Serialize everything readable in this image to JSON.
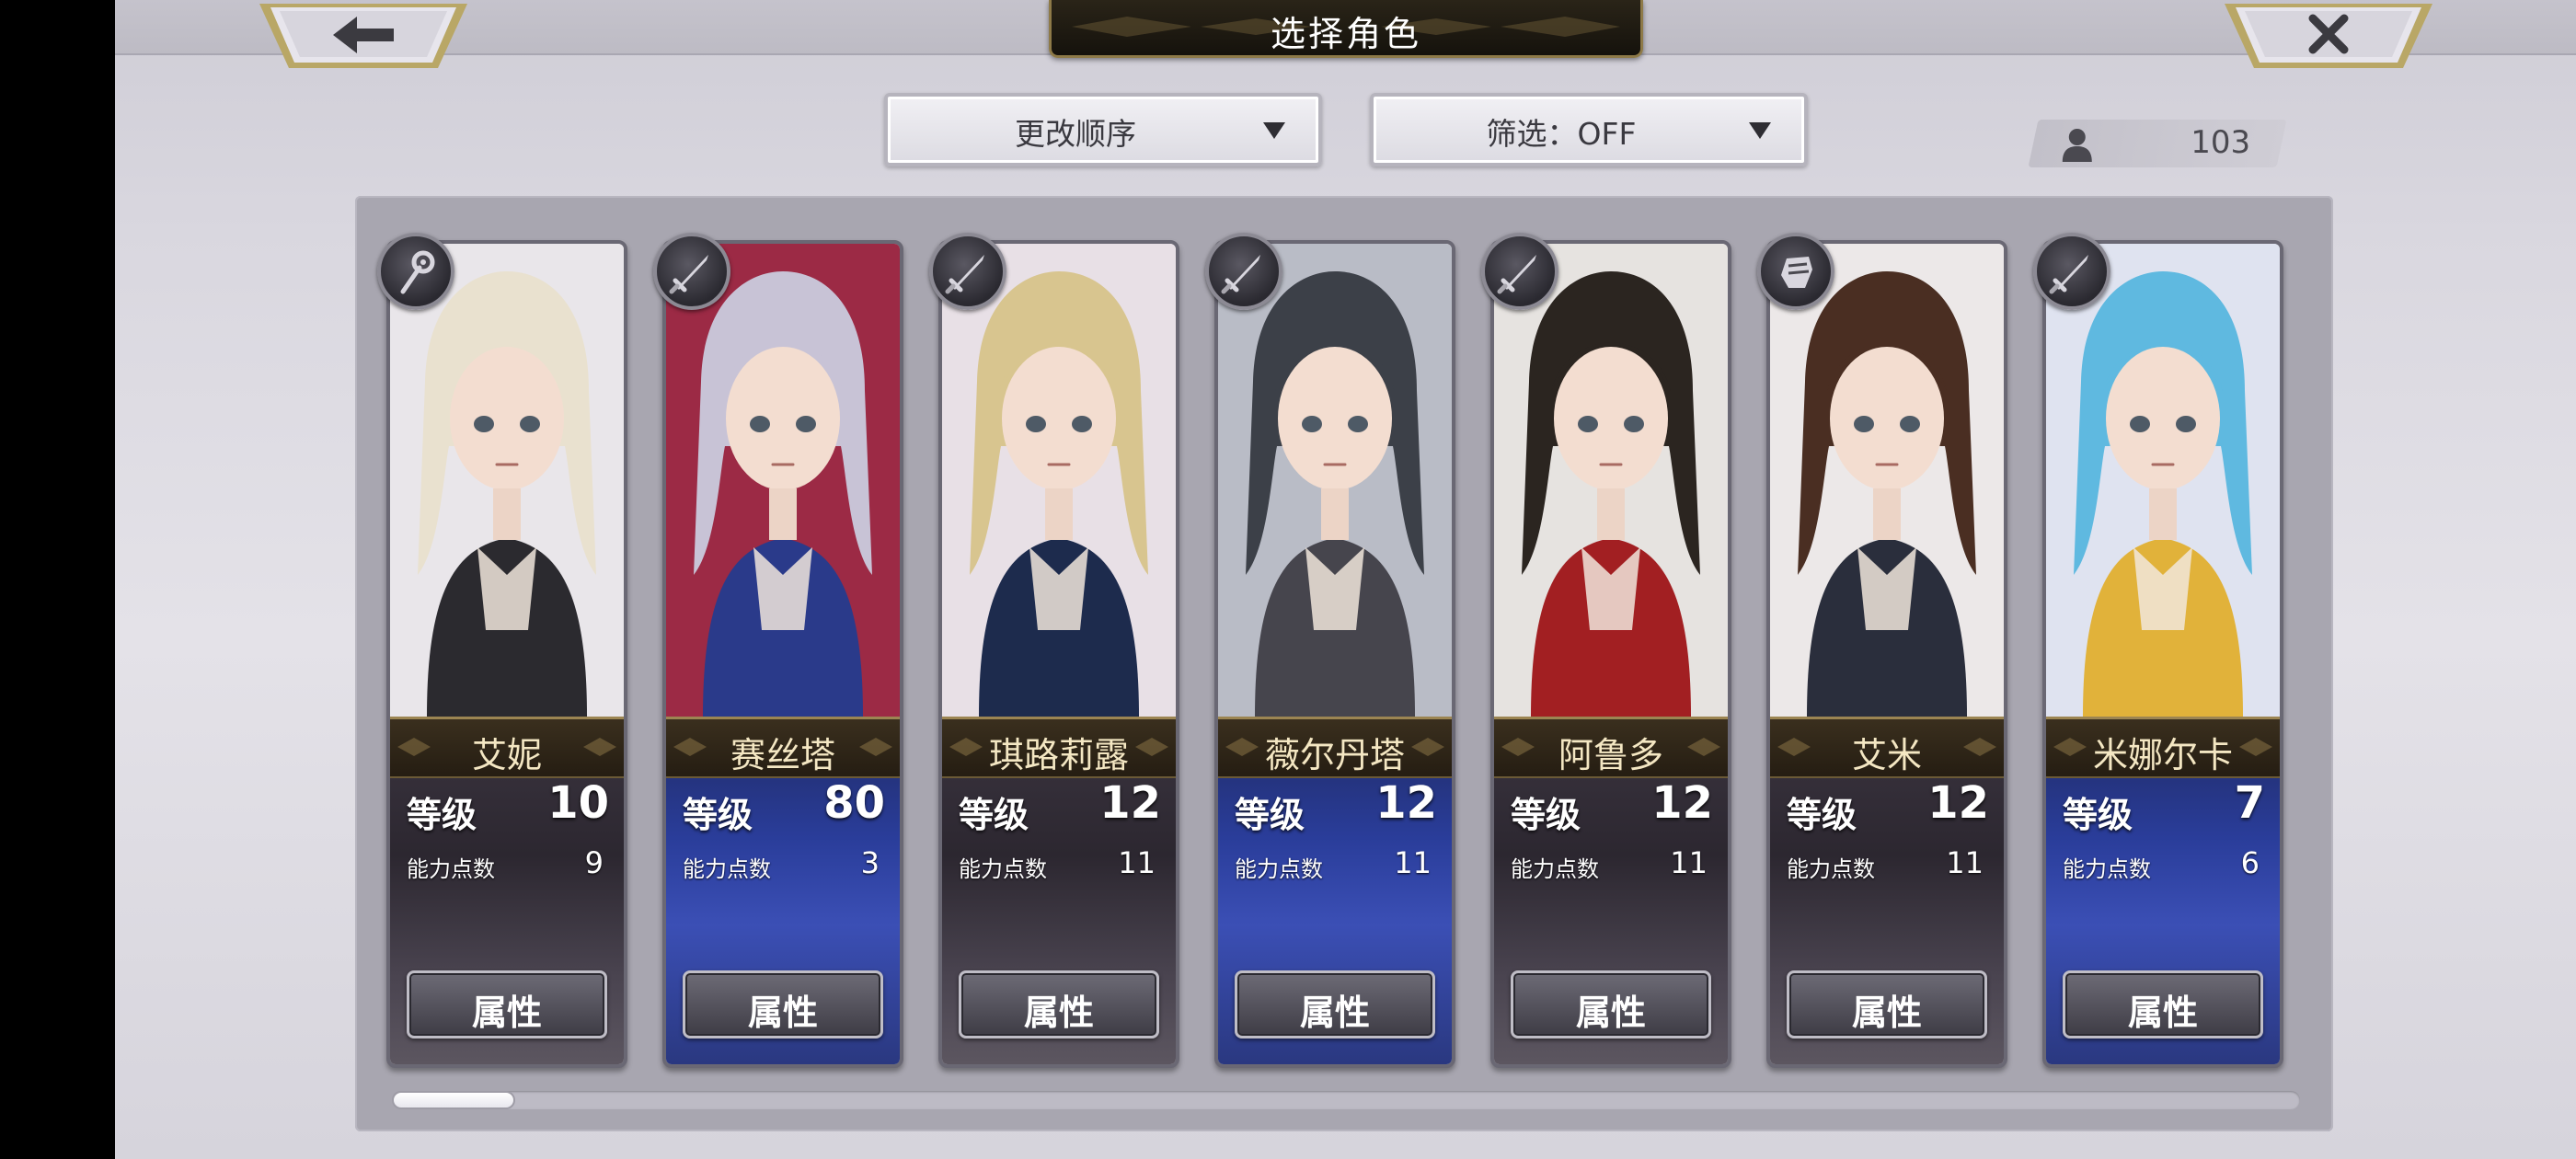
{
  "screen": {
    "title": "选择角色",
    "back_icon": "left-arrow-icon",
    "close_icon": "close-x-icon"
  },
  "controls": {
    "sort_label": "更改顺序",
    "filter_label": "筛选：OFF",
    "roster_count": "103"
  },
  "labels": {
    "level": "等级",
    "ability_points": "能力点数",
    "attribute_button": "属性"
  },
  "characters": [
    {
      "name": "艾妮",
      "level": "10",
      "ability_points": "9",
      "weapon_icon": "staff-icon",
      "theme": "dark",
      "hair": "#e9e1cf",
      "outfit": "#2b2a2f",
      "bg": "#e9e6ea"
    },
    {
      "name": "赛丝塔",
      "level": "80",
      "ability_points": "3",
      "weapon_icon": "sword-icon",
      "theme": "blue",
      "hair": "#c8c3d6",
      "outfit": "#2a3a8a",
      "bg": "#9c2a45"
    },
    {
      "name": "琪路莉露",
      "level": "12",
      "ability_points": "11",
      "weapon_icon": "sword-icon",
      "theme": "dark",
      "hair": "#d8c58f",
      "outfit": "#1d2b4d",
      "bg": "#e8e0e6"
    },
    {
      "name": "薇尔丹塔",
      "level": "12",
      "ability_points": "11",
      "weapon_icon": "sword-icon",
      "theme": "blue",
      "hair": "#3c4048",
      "outfit": "#46454d",
      "bg": "#b9bcc6"
    },
    {
      "name": "阿鲁多",
      "level": "12",
      "ability_points": "11",
      "weapon_icon": "sword-icon",
      "theme": "dark",
      "hair": "#2b2520",
      "outfit": "#a21f22",
      "bg": "#e6e3e0"
    },
    {
      "name": "艾米",
      "level": "12",
      "ability_points": "11",
      "weapon_icon": "gauntlet-icon",
      "theme": "dark",
      "hair": "#4a2e22",
      "outfit": "#2a2e3c",
      "bg": "#ece8e8"
    },
    {
      "name": "米娜尔卡",
      "level": "7",
      "ability_points": "6",
      "weapon_icon": "sword-icon",
      "theme": "blue",
      "hair": "#5fb9e0",
      "outfit": "#e1b23a",
      "bg": "#dfe3f0"
    }
  ]
}
